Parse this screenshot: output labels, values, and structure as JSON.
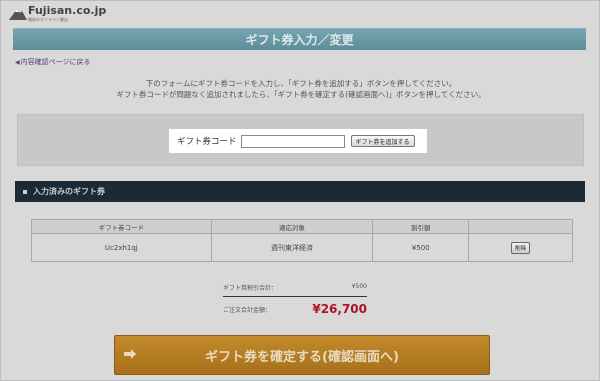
{
  "logo": {
    "text": "Fujisan.co.jp",
    "sub": "雑誌のオンライン書店"
  },
  "header": {
    "title": "ギフト券入力／変更"
  },
  "back_link": "内容確認ページに戻る",
  "instructions": {
    "line1": "下のフォームにギフト券コードを入力し、「ギフト券を追加する」ボタンを押してください。",
    "line2": "ギフト券コードが問題なく追加されましたら、「ギフト券を確定する(確認画面へ)」ボタンを押してください。"
  },
  "form": {
    "label": "ギフト券コード",
    "input_value": "",
    "input_placeholder": "",
    "add_button": "ギフト券を追加する"
  },
  "section": {
    "title": "入力済みのギフト券"
  },
  "table": {
    "headers": [
      "ギフト券コード",
      "適応対象",
      "割引額",
      ""
    ],
    "rows": [
      {
        "code": "Uc2xh1qj",
        "target": "週刊東洋経済",
        "discount": "¥500",
        "action": "削除"
      }
    ]
  },
  "summary": {
    "gift_label": "ギフト券割引合計：",
    "gift_value": "¥500",
    "total_label": "ご注文合計金額：",
    "total_value": "¥26,700"
  },
  "confirm_button": "ギフト券を確定する(確認画面へ)",
  "colors": {
    "header": "#6a9aa5",
    "section_bar": "#1e2a33",
    "confirm": "#b57c23",
    "total": "#b0112a"
  }
}
